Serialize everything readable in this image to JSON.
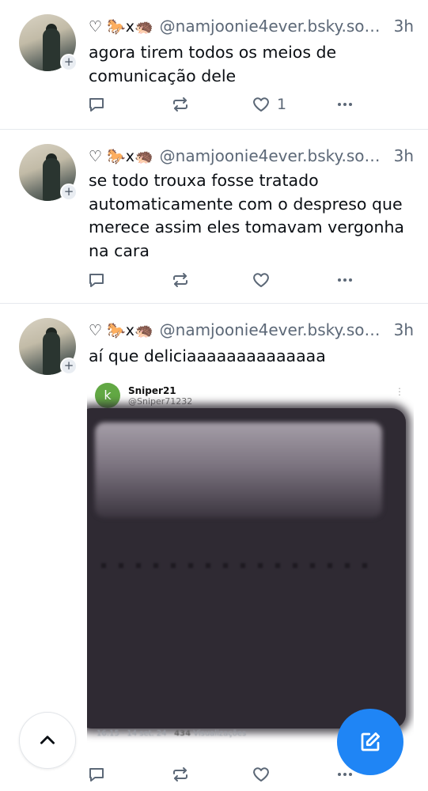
{
  "posts": [
    {
      "emoji_prefix": "♡ 🐎x🦔",
      "handle": "@namjoonie4ever.bsky.soci…",
      "time": "3h",
      "text_lines": [
        "agora tirem todos os meios de",
        "comunicação dele"
      ],
      "like_count": "1"
    },
    {
      "emoji_prefix": "♡ 🐎x🦔",
      "handle": "@namjoonie4ever.bsky.soci…",
      "time": "3h",
      "text_lines": [
        "se todo trouxa fosse tratado",
        "automaticamente com o despreso que",
        "merece assim eles tomavam vergonha",
        "na cara"
      ],
      "like_count": ""
    },
    {
      "emoji_prefix": "♡ 🐎x🦔",
      "handle": "@namjoonie4ever.bsky.soci…",
      "time": "3h",
      "text_lines": [
        "aí que deliciaaaaaaaaaaaaaa"
      ],
      "like_count": "",
      "embed": {
        "avatar_letter": "k",
        "display_name": "Sniper21",
        "username": "@Sniper71232",
        "footer_time": "16:15 · 14 set. 24 ·",
        "footer_views": "434",
        "footer_views_label": "Visualizações"
      }
    }
  ],
  "icons": {
    "reply": "reply-icon",
    "repost": "repost-icon",
    "like": "heart-icon",
    "more": "more-icon",
    "scroll_top": "chevron-up-icon",
    "compose": "compose-icon"
  },
  "colors": {
    "accent": "#1f85f5",
    "muted": "#5c6877",
    "embed_avatar": "#62a844"
  }
}
